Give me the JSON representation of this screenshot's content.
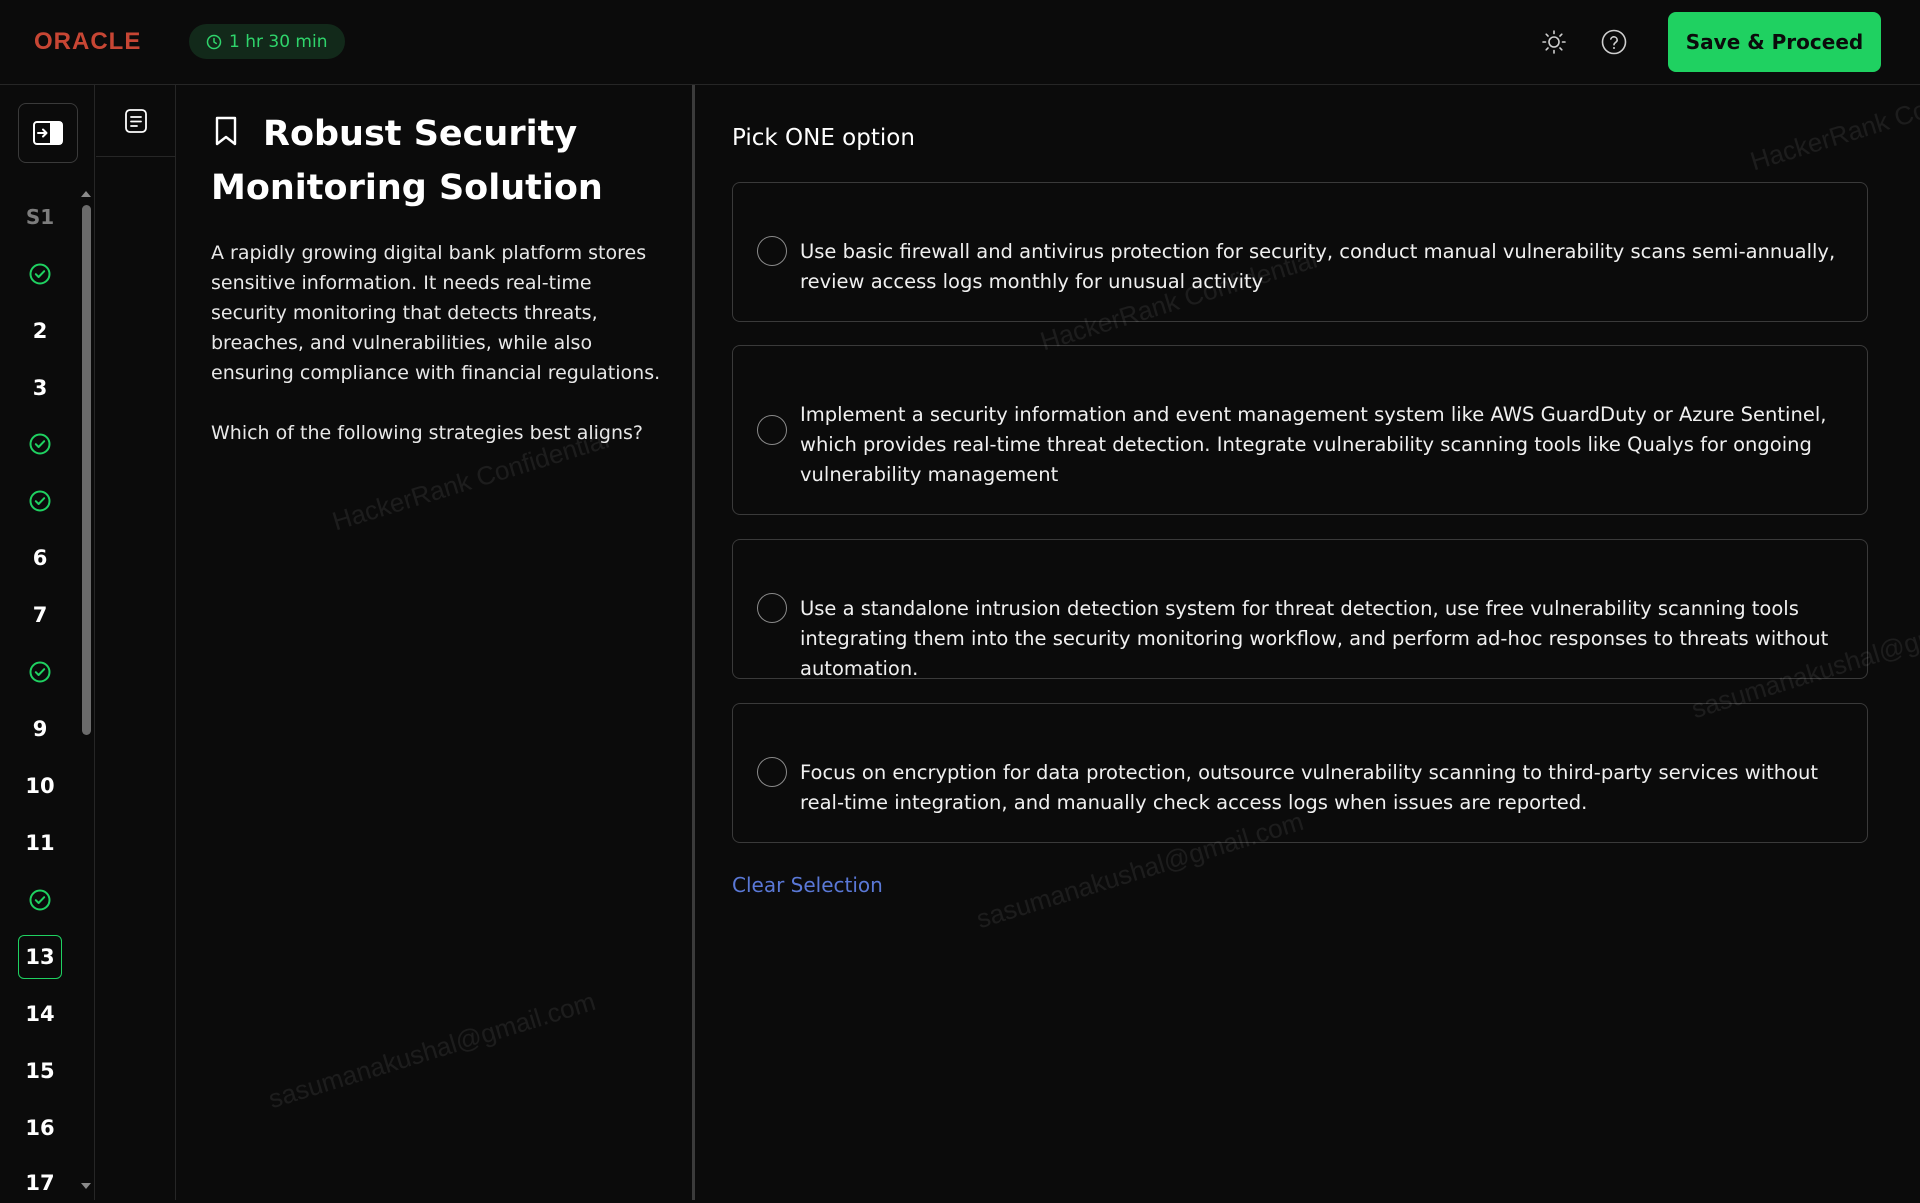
{
  "header": {
    "logo": "ORACLE",
    "timer": "1 hr 30 min",
    "theme_icon": "sun-icon",
    "help_icon": "help-circle-icon",
    "save_label": "Save & Proceed"
  },
  "nav": {
    "items": [
      {
        "label": "S1",
        "status": "section"
      },
      {
        "label": "",
        "status": "done"
      },
      {
        "label": "2",
        "status": "todo"
      },
      {
        "label": "3",
        "status": "todo"
      },
      {
        "label": "",
        "status": "done"
      },
      {
        "label": "",
        "status": "done"
      },
      {
        "label": "6",
        "status": "todo"
      },
      {
        "label": "7",
        "status": "todo"
      },
      {
        "label": "",
        "status": "done"
      },
      {
        "label": "9",
        "status": "todo"
      },
      {
        "label": "10",
        "status": "todo"
      },
      {
        "label": "11",
        "status": "todo"
      },
      {
        "label": "",
        "status": "done"
      },
      {
        "label": "13",
        "status": "current"
      },
      {
        "label": "14",
        "status": "todo"
      },
      {
        "label": "15",
        "status": "todo"
      },
      {
        "label": "16",
        "status": "todo"
      },
      {
        "label": "17",
        "status": "todo"
      }
    ]
  },
  "question": {
    "title": "Robust Security Monitoring Solution",
    "body": "A rapidly growing digital bank platform stores sensitive information. It needs real-time security monitoring that detects threats, breaches, and vulnerabilities, while also ensuring compliance with financial regulations.",
    "prompt": "Which of the following strategies best aligns?"
  },
  "answers": {
    "pick_label": "Pick ONE option",
    "options": [
      "Use basic firewall and antivirus protection for security, conduct manual vulnerability scans semi-annually, review access logs monthly for unusual activity",
      "Implement a security information and event management system like AWS GuardDuty or Azure Sentinel, which provides real-time threat detection. Integrate vulnerability scanning tools like Qualys for ongoing vulnerability management",
      "Use a standalone intrusion detection system for threat detection, use free vulnerability scanning tools integrating them into the security monitoring workflow, and perform ad-hoc responses to threats without automation.",
      "Focus on encryption for data protection, outsource vulnerability scanning to third-party services without real-time integration, and manually check access logs when issues are reported."
    ],
    "clear_label": "Clear Selection"
  },
  "watermarks": {
    "confidential": "HackerRank Confidential",
    "email": "sasumanakushal@gmail.com"
  },
  "colors": {
    "accent": "#1fd161",
    "brand": "#c74634",
    "link": "#5a78d6"
  }
}
